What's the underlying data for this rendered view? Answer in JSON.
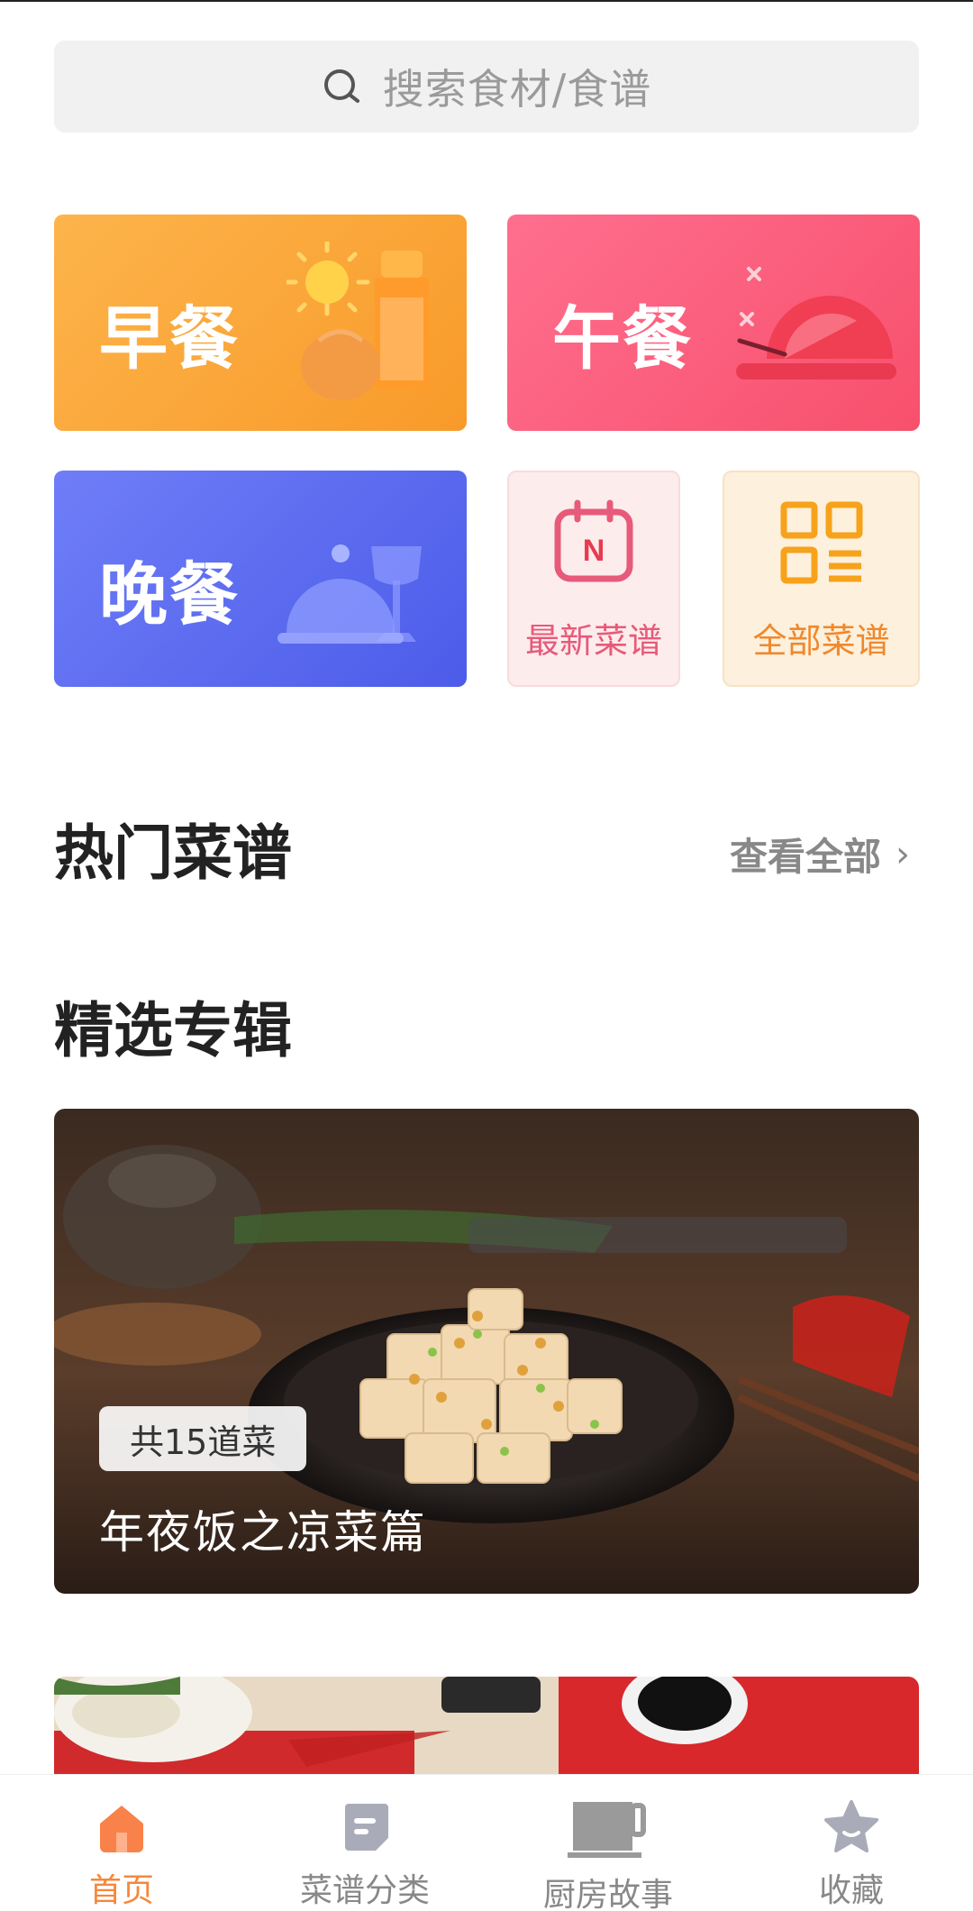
{
  "search": {
    "placeholder": "搜索食材/食谱"
  },
  "meal_tiles": {
    "breakfast": "早餐",
    "lunch": "午餐",
    "dinner": "晚餐"
  },
  "quick_tiles": {
    "newest": "最新菜谱",
    "all": "全部菜谱",
    "calendar_letter": "N"
  },
  "hot_recipes": {
    "title": "热门菜谱",
    "view_all": "查看全部"
  },
  "featured": {
    "title": "精选专辑",
    "albums": [
      {
        "count": "共15道菜",
        "name": "年夜饭之凉菜篇"
      }
    ]
  },
  "bottom_nav": {
    "items": [
      {
        "label": "首页",
        "icon": "home-icon",
        "active": true
      },
      {
        "label": "菜谱分类",
        "icon": "document-icon",
        "active": false
      },
      {
        "label": "厨房故事",
        "icon": "cup-icon",
        "active": false
      },
      {
        "label": "收藏",
        "icon": "star-icon",
        "active": false
      }
    ]
  },
  "colors": {
    "breakfast": "#f89a2a",
    "lunch": "#f7506c",
    "dinner": "#4c5ce9",
    "accent": "#f7873a"
  }
}
